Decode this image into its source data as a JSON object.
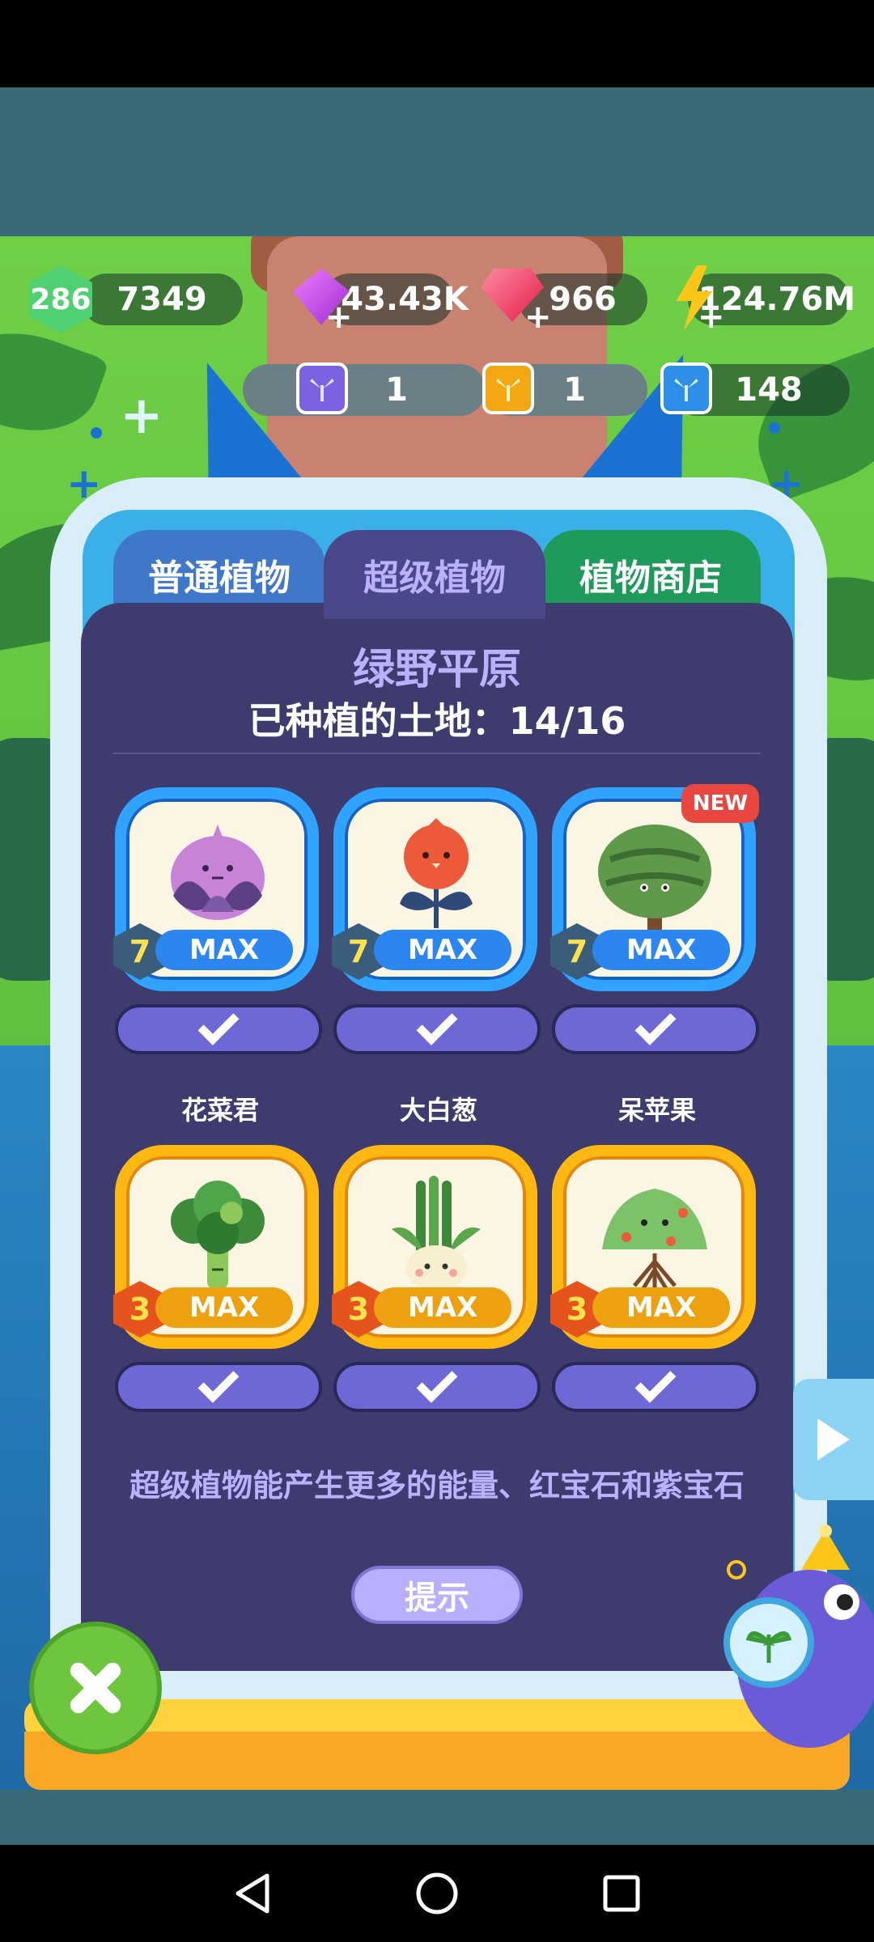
{
  "resources": {
    "level": "286",
    "energy": "7349",
    "purple_gems": "43.43K",
    "red_gems": "966",
    "power": "124.76M",
    "seeds_purple": "1",
    "seeds_gold": "1",
    "seeds_blue": "148"
  },
  "tabs": [
    {
      "label": "普通植物"
    },
    {
      "label": "超级植物"
    },
    {
      "label": "植物商店"
    }
  ],
  "panel": {
    "title": "绿野平原",
    "subtitle": "已种植的土地：14/16",
    "footer": "超级植物能产生更多的能量、红宝石和紫宝石",
    "hint_label": "提示"
  },
  "plants_row1": [
    {
      "level": "7",
      "max_label": "MAX",
      "tier": "blue",
      "art": "onion-icon"
    },
    {
      "level": "7",
      "max_label": "MAX",
      "tier": "blue",
      "art": "flower-icon"
    },
    {
      "level": "7",
      "max_label": "MAX",
      "tier": "blue",
      "art": "tree-icon",
      "badge": "NEW"
    }
  ],
  "plants_row2": [
    {
      "name": "花菜君",
      "level": "3",
      "max_label": "MAX",
      "tier": "gold",
      "art": "broccoli-icon"
    },
    {
      "name": "大白葱",
      "level": "3",
      "max_label": "MAX",
      "tier": "gold",
      "art": "leek-icon"
    },
    {
      "name": "呆苹果",
      "level": "3",
      "max_label": "MAX",
      "tier": "gold",
      "art": "apple-tree-icon"
    }
  ],
  "colors": {
    "panel": "#3e3b6e",
    "accent_purple": "#b9b2ff",
    "tab_blue": "#3f78c8",
    "tab_active": "#4a478a",
    "tab_green": "#1e9a5b"
  }
}
